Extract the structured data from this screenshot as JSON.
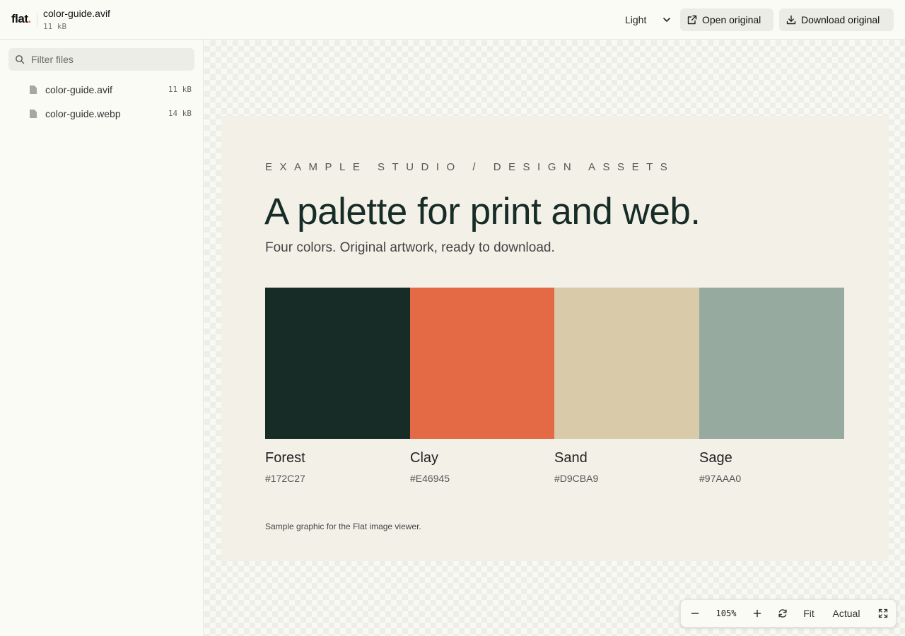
{
  "header": {
    "logo_text": "flat",
    "logo_dot": ".",
    "file_title": "color-guide.avif",
    "file_size": "11 kB",
    "theme": {
      "selected": "Light",
      "options": [
        "Light"
      ]
    },
    "open_label": "Open original",
    "download_label": "Download original"
  },
  "sidebar": {
    "filter_placeholder": "Filter files",
    "files": [
      {
        "name": "color-guide.avif",
        "size": "11 kB"
      },
      {
        "name": "color-guide.webp",
        "size": "14 kB"
      }
    ]
  },
  "artwork": {
    "eyebrow": "EXAMPLE STUDIO / DESIGN ASSETS",
    "headline": "A palette for print and web.",
    "subline": "Four colors. Original artwork, ready to download.",
    "swatches": [
      {
        "name": "Forest",
        "hex": "#172C27"
      },
      {
        "name": "Clay",
        "hex": "#E46945"
      },
      {
        "name": "Sand",
        "hex": "#D9CBA9"
      },
      {
        "name": "Sage",
        "hex": "#97AAA0"
      }
    ],
    "caption": "Sample graphic for the Flat image viewer."
  },
  "zoom": {
    "level": "105%",
    "fit_label": "Fit",
    "actual_label": "Actual"
  },
  "colors": {
    "accent": "#e46945",
    "background": "#fbfbf6",
    "artwork_bg": "#f3f0e8"
  },
  "icons": [
    "search-icon",
    "file-icon",
    "external-link-icon",
    "download-icon",
    "chevron-down-icon",
    "minus-icon",
    "plus-icon",
    "reset-icon",
    "fullscreen-icon"
  ]
}
